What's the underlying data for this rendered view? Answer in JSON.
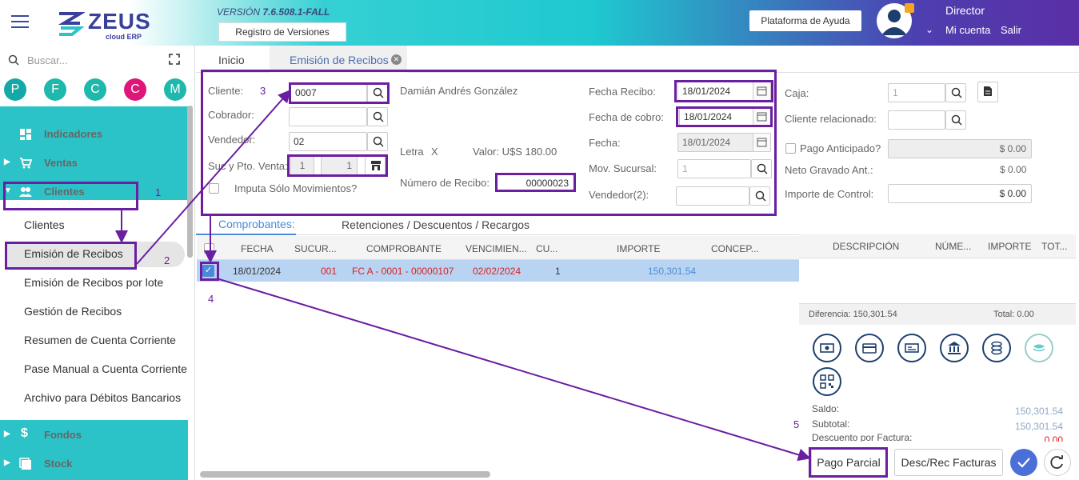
{
  "header": {
    "version_label": "VERSIÓN",
    "version_number": "7.6.508.1-FALL",
    "registro_button": "Registro de Versiones",
    "ayuda_button": "Plataforma de Ayuda",
    "user_role": "Director",
    "mi_cuenta": "Mi cuenta",
    "salir": "Salir",
    "logo_text": "ZEUS",
    "logo_sub": "cloud ERP"
  },
  "sidebar": {
    "search_placeholder": "Buscar...",
    "circles": [
      {
        "letter": "P",
        "color": "#14a8a8"
      },
      {
        "letter": "F",
        "color": "#1fb8ad"
      },
      {
        "letter": "C",
        "color": "#1fb8ad"
      },
      {
        "letter": "C",
        "color": "#e0157a"
      },
      {
        "letter": "M",
        "color": "#1fb8ad"
      }
    ],
    "nav": {
      "indicadores": "Indicadores",
      "ventas": "Ventas",
      "clientes": "Clientes",
      "fondos": "Fondos",
      "stock": "Stock"
    },
    "subitems": [
      "Clientes",
      "Emisión de Recibos",
      "Emisión de Recibos por lote",
      "Gestión de Recibos",
      "Resumen de Cuenta Corriente",
      "Pase Manual a Cuenta Corriente",
      "Archivo para Débitos Bancarios"
    ]
  },
  "tabs": {
    "inicio": "Inicio",
    "active": "Emisión de Recibos"
  },
  "form": {
    "cliente_label": "Cliente:",
    "cliente_value": "0007",
    "cliente_name": "Damián Andrés González",
    "cobrador_label": "Cobrador:",
    "vendedor_label": "Vendedor:",
    "vendedor_value": "02",
    "suc_label": "Suc y Pto. Venta:",
    "suc_value": "1",
    "pto_value": "1",
    "imputa_label": "Imputa Sólo Movimientos?",
    "letra_label": "Letra",
    "letra_value": "X",
    "valor_label": "Valor: U$S 180.00",
    "numero_label": "Número de Recibo:",
    "numero_value": "00000023",
    "fecha_recibo_label": "Fecha Recibo:",
    "fecha_recibo_value": "18/01/2024",
    "fecha_cobro_label": "Fecha de cobro:",
    "fecha_cobro_value": "18/01/2024",
    "fecha_label": "Fecha:",
    "fecha_value": "18/01/2024",
    "mov_suc_label": "Mov. Sucursal:",
    "mov_suc_value": "1",
    "vendedor2_label": "Vendedor(2):",
    "caja_label": "Caja:",
    "caja_value": "1",
    "cliente_rel_label": "Cliente relacionado:",
    "pago_anticipado_label": "Pago Anticipado?",
    "pago_anticipado_value": "$ 0.00",
    "neto_label": "Neto Gravado Ant.:",
    "neto_value": "$ 0.00",
    "importe_control_label": "Importe de Control:",
    "importe_control_value": "$ 0.00"
  },
  "grid": {
    "tab_comprobantes": "Comprobantes:",
    "tab_retenciones": "Retenciones / Descuentos / Recargos",
    "headers": [
      "FECHA",
      "SUCUR...",
      "COMPROBANTE",
      "VENCIMIEN...",
      "CU...",
      "IMPORTE",
      "CONCEP..."
    ],
    "row": {
      "fecha": "18/01/2024",
      "sucursal": "001",
      "comprobante": "FC A - 0001 - 00000107",
      "vencimiento": "02/02/2024",
      "cuota": "1",
      "importe": "150,301.54"
    }
  },
  "right_panel": {
    "headers": [
      "DESCRIPCIÓN",
      "NÚME...",
      "IMPORTE",
      "TOT..."
    ],
    "diferencia": "Diferencia: 150,301.54",
    "total": "Total: 0.00",
    "saldo_label": "Saldo:",
    "saldo_value": "150,301.54",
    "subtotal_label": "Subtotal:",
    "subtotal_value": "150,301.54",
    "descuento_label": "Descuento por Factura:",
    "descuento_value": "0.00"
  },
  "buttons": {
    "pago_parcial": "Pago Parcial",
    "desc_rec": "Desc/Rec Facturas"
  },
  "annotations": [
    "1",
    "2",
    "3",
    "4",
    "5"
  ],
  "colors": {
    "accent": "#2cc3c8",
    "annotation": "#6a1ea0",
    "selected_row": "#b9d4f2",
    "red_text": "#e02020",
    "link_blue": "#4a8ad8"
  }
}
